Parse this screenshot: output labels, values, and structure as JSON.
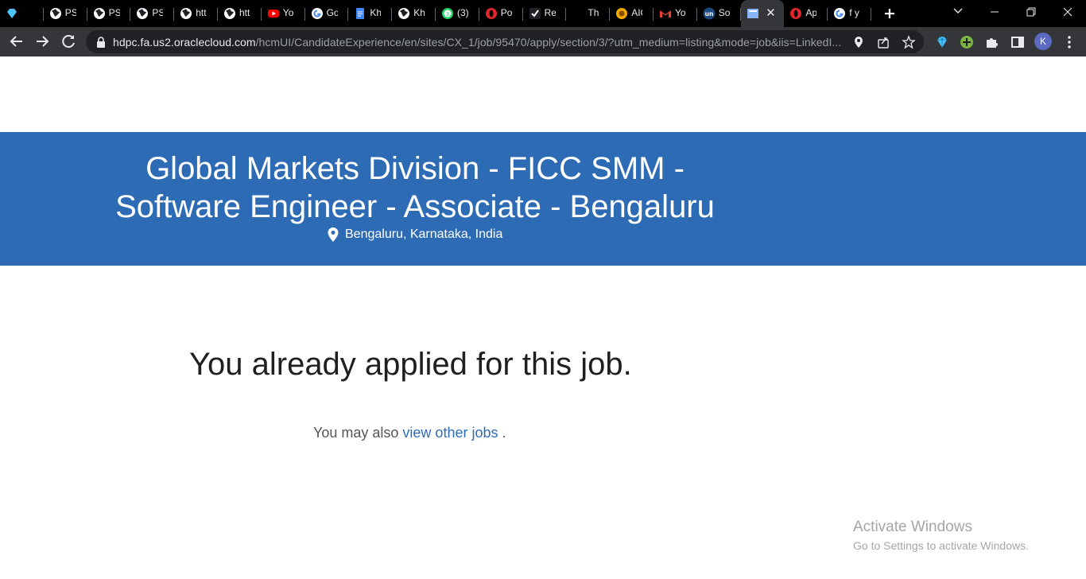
{
  "tabs": [
    {
      "title": "",
      "icon": "gem-icon"
    },
    {
      "title": "PSI",
      "icon": "globe-icon"
    },
    {
      "title": "PSI",
      "icon": "globe-icon"
    },
    {
      "title": "PSI",
      "icon": "globe-icon"
    },
    {
      "title": "htt",
      "icon": "globe-icon"
    },
    {
      "title": "htt",
      "icon": "globe-icon"
    },
    {
      "title": "You",
      "icon": "youtube-icon"
    },
    {
      "title": "Go",
      "icon": "google-icon"
    },
    {
      "title": "Kh",
      "icon": "docs-icon"
    },
    {
      "title": "Kh",
      "icon": "globe-icon"
    },
    {
      "title": "(3)",
      "icon": "whatsapp-icon"
    },
    {
      "title": "Pot",
      "icon": "opera-icon"
    },
    {
      "title": "Rec",
      "icon": "check-icon"
    },
    {
      "title": "Th",
      "icon": "blank-icon"
    },
    {
      "title": "AIC",
      "icon": "emblem-icon"
    },
    {
      "title": "You",
      "icon": "gmail-icon"
    },
    {
      "title": "Sol",
      "icon": "unstop-icon"
    },
    {
      "title": "",
      "icon": "page-icon",
      "active": true
    },
    {
      "title": "Ap",
      "icon": "opera-icon"
    },
    {
      "title": "f y",
      "icon": "google-icon"
    }
  ],
  "toolbar": {
    "url_host": "hdpc.fa.us2.oraclecloud.com",
    "url_rest": "/hcmUI/CandidateExperience/en/sites/CX_1/job/95470/apply/section/3/?utm_medium=listing&mode=job&iis=LinkedI...",
    "avatar_letter": "K"
  },
  "job": {
    "title": "Global Markets Division - FICC SMM - Software Engineer - Associate - Bengaluru",
    "location": "Bengaluru, Karnataka, India"
  },
  "message": {
    "heading": "You already applied for this job.",
    "also_prefix": "You may also",
    "link_text": "view other jobs",
    "suffix": "."
  },
  "watermark": {
    "line1": "Activate Windows",
    "line2": "Go to Settings to activate Windows."
  }
}
